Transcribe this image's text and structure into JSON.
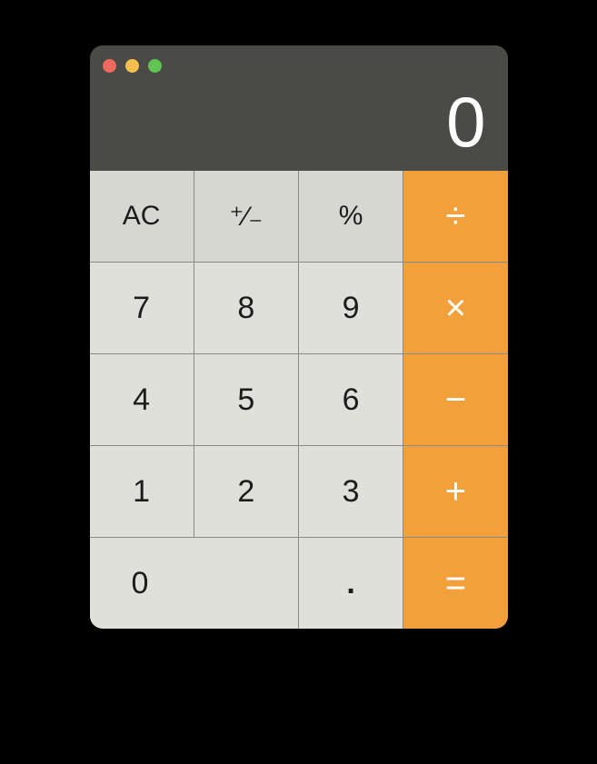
{
  "display": {
    "value": "0"
  },
  "buttons": {
    "clear": "AC",
    "negate": "⁺⁄₋",
    "percent": "%",
    "divide": "÷",
    "multiply": "×",
    "subtract": "−",
    "add": "+",
    "equals": "=",
    "decimal": ".",
    "d0": "0",
    "d1": "1",
    "d2": "2",
    "d3": "3",
    "d4": "4",
    "d5": "5",
    "d6": "6",
    "d7": "7",
    "d8": "8",
    "d9": "9"
  },
  "colors": {
    "window_bg": "#4a4a46",
    "func_bg": "#d7d7d2",
    "num_bg": "#e0e0db",
    "op_bg": "#f2a03c",
    "traffic_close": "#ec6a5e",
    "traffic_min": "#f5bf4f",
    "traffic_max": "#61c554"
  }
}
